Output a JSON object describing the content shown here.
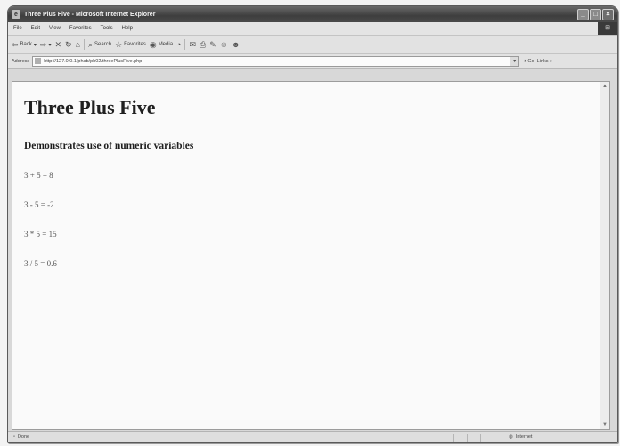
{
  "window": {
    "title": "Three Plus Five - Microsoft Internet Explorer"
  },
  "window_buttons": {
    "minimize": "_",
    "maximize": "□",
    "close": "×"
  },
  "menu": {
    "items": [
      "File",
      "Edit",
      "View",
      "Favorites",
      "Tools",
      "Help"
    ]
  },
  "toolbar": {
    "back": "Back",
    "forward": "⇨",
    "stop": "✕",
    "refresh": "↻",
    "home": "⌂",
    "search": "Search",
    "favorites": "Favorites",
    "media": "Media",
    "history": "◔",
    "mail": "✉",
    "print": "⎙",
    "edit": "✎",
    "discuss": "☺",
    "messenger": "☻"
  },
  "address": {
    "label": "Address",
    "url": "http://127.0.0.1/phab/ph02/threePlusFive.php",
    "go": "Go",
    "links": "Links »"
  },
  "page": {
    "heading": "Three Plus Five",
    "subheading": "Demonstrates use of numeric variables",
    "lines": [
      "3 + 5 = 8",
      "3 - 5 = -2",
      "3 * 5 = 15",
      "3 / 5 = 0.6"
    ]
  },
  "status": {
    "left": "Done",
    "zone": "Internet"
  },
  "icons": {
    "app": "ie-icon",
    "back": "back-arrow-icon",
    "forward": "forward-arrow-icon",
    "stop": "stop-icon",
    "refresh": "refresh-icon",
    "home": "home-icon",
    "search": "search-icon",
    "favorites": "star-icon",
    "media": "media-icon",
    "history": "history-icon",
    "mail": "mail-icon",
    "print": "print-icon",
    "edit": "edit-icon",
    "discuss": "discuss-icon",
    "messenger": "messenger-icon",
    "page": "page-icon",
    "go": "go-arrow-icon",
    "zone": "globe-icon"
  }
}
